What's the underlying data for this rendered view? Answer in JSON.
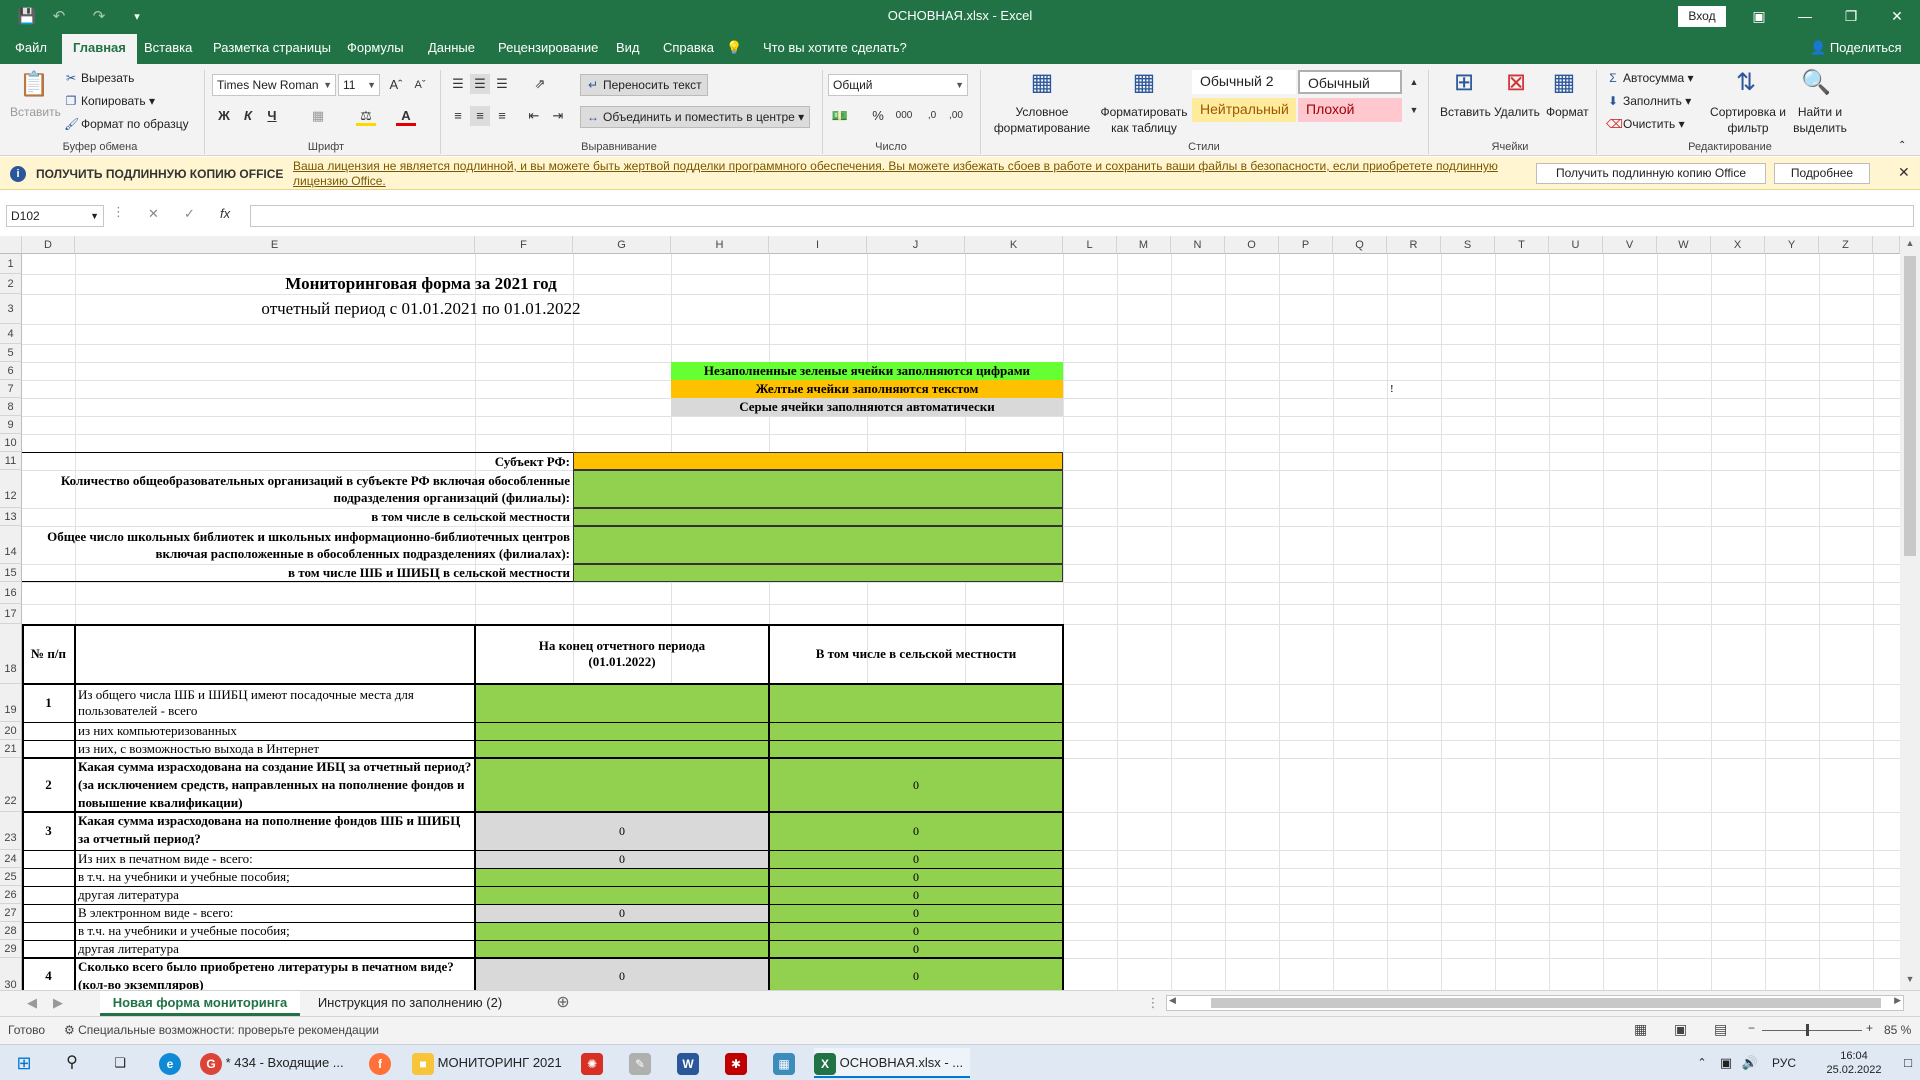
{
  "window": {
    "title": "ОСНОВНАЯ.xlsx  -  Excel",
    "login_label": "Вход"
  },
  "ribbon_tabs": [
    "Файл",
    "Главная",
    "Вставка",
    "Разметка страницы",
    "Формулы",
    "Данные",
    "Рецензирование",
    "Вид",
    "Справка",
    "Что вы хотите сделать?"
  ],
  "share_label": "Поделиться",
  "clipboard": {
    "paste": "Вставить",
    "cut": "Вырезать",
    "copy": "Копировать",
    "format_painter": "Формат по образцу",
    "group": "Буфер обмена"
  },
  "font": {
    "name": "Times New Roman",
    "size": "11",
    "group": "Шрифт"
  },
  "alignment": {
    "wrap": "Переносить текст",
    "merge": "Объединить и поместить в центре",
    "group": "Выравнивание"
  },
  "number": {
    "format": "Общий",
    "group": "Число"
  },
  "styles": {
    "conditional": "Условное форматирование",
    "as_table": "Форматировать как таблицу",
    "normal2": "Обычный 2",
    "normal": "Обычный",
    "neutral": "Нейтральный",
    "bad": "Плохой",
    "group": "Стили"
  },
  "cells_group": {
    "insert": "Вставить",
    "delete": "Удалить",
    "format": "Формат",
    "group": "Ячейки"
  },
  "editing": {
    "autosum": "Автосумма",
    "fill": "Заполнить",
    "clear": "Очистить",
    "sort": "Сортировка и фильтр",
    "find": "Найти и выделить",
    "group": "Редактирование"
  },
  "message_bar": {
    "title": "ПОЛУЧИТЬ ПОДЛИННУЮ КОПИЮ OFFICE",
    "text": "Ваша лицензия не является подлинной, и вы можете быть жертвой подделки программного обеспечения. Вы можете избежать сбоев в работе и сохранить ваши файлы в безопасности, если приобретете подлинную лицензию Office.",
    "btn_get": "Получить подлинную копию Office",
    "btn_more": "Подробнее"
  },
  "formula_bar": {
    "name_box": "D102",
    "fx": "fx"
  },
  "columns": [
    "D",
    "E",
    "F",
    "G",
    "H",
    "I",
    "J",
    "K",
    "L",
    "M",
    "N",
    "O",
    "P",
    "Q",
    "R",
    "S",
    "T",
    "U",
    "V",
    "W",
    "X",
    "Y",
    "Z"
  ],
  "rows": [
    "1",
    "2",
    "3",
    "4",
    "5",
    "6",
    "7",
    "8",
    "9",
    "10",
    "11",
    "12",
    "13",
    "14",
    "15",
    "16",
    "17",
    "18",
    "19",
    "20",
    "21",
    "22",
    "23",
    "24",
    "25",
    "26",
    "27",
    "28",
    "29",
    "30"
  ],
  "sheet": {
    "title": "Мониторинговая форма за 2021 год",
    "period": "отчетный период с 01.01.2021 по 01.01.2022",
    "legend_green": "Незаполненные зеленые ячейки заполняются цифрами",
    "legend_yellow": "Желтые ячейки заполняются текстом",
    "legend_gray": "Серые ячейки заполняются автоматически",
    "r7_mark": "!",
    "subject": "Субъект РФ:",
    "orgs": "Количество общеобразовательных организаций в субъекте РФ включая обособленные подразделения организаций (филиалы):",
    "orgs_rural": "в том числе  в сельской местности",
    "libs": "Общее число школьных библиотек и школьных информационно-библиотечных центров включая расположенные в обособленных подразделениях (филиалах):",
    "libs_rural": "в том числе ШБ и ШИБЦ в сельской местности",
    "h_num": "№ п/п",
    "h_end": "На конец отчетного периода (01.01.2022)",
    "h_rural": "В том числе в сельской местности",
    "r19_n": "1",
    "r19": "Из общего числа ШБ и ШИБЦ  имеют посадочные места для пользователей - всего",
    "r20": "из них компьютеризованных",
    "r21": "из них, с возможностью выхода в Интернет",
    "r22_n": "2",
    "r22": "Какая сумма израсходована на создание ИБЦ за отчетный период? (за исключением средств, направленных на пополнение фондов и повышение квалификации)",
    "r22_j": "0",
    "r23_n": "3",
    "r23": "Какая сумма израсходована на пополнение фондов ШБ и ШИБЦ за отчетный период?",
    "r23_g": "0",
    "r23_j": "0",
    "r24": "Из них в печатном виде - всего:",
    "r24_g": "0",
    "r24_j": "0",
    "r25": "в т.ч. на учебники и учебные пособия;",
    "r25_j": "0",
    "r26": "другая литература",
    "r26_j": "0",
    "r27": "В электронном виде - всего:",
    "r27_g": "0",
    "r27_j": "0",
    "r28": "в т.ч. на учебники и учебные пособия;",
    "r28_j": "0",
    "r29": "другая литература",
    "r29_j": "0",
    "r30_n": "4",
    "r30": "Сколько всего было приобретено литературы в печатном виде? (кол-во экземпляров)",
    "r30_g": "0",
    "r30_j": "0"
  },
  "sheet_tabs": [
    "Новая форма мониторинга",
    "Инструкция по заполнению (2)"
  ],
  "status": {
    "ready": "Готово",
    "accessibility": "Специальные возможности: проверьте рекомендации",
    "zoom": "85 %"
  },
  "taskbar": {
    "chrome": "* 434 - Входящие ...",
    "folder": "МОНИТОРИНГ 2021",
    "excel": "ОСНОВНАЯ.xlsx - ...",
    "lang": "РУС",
    "time": "16:04",
    "date": "25.02.2022"
  },
  "colors": {
    "excel_green": "#217346",
    "cell_green": "#92d050",
    "cell_orange": "#ffc000",
    "cell_gray": "#d9d9d9"
  }
}
